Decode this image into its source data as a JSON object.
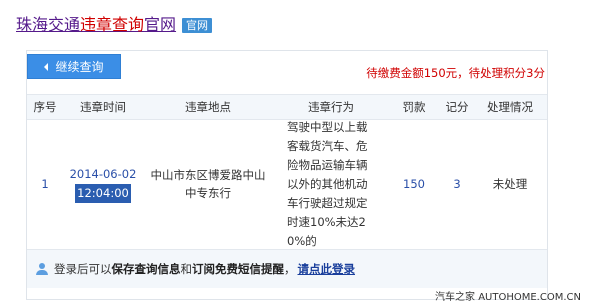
{
  "header": {
    "title_part1": "珠海交通",
    "title_highlight": "违章查询",
    "title_part2": "官网",
    "badge": "官网"
  },
  "toolbar": {
    "continue_label": "继续查询",
    "summary": "待缴费金额150元，待处理积分3分"
  },
  "table": {
    "columns": [
      "序号",
      "违章时间",
      "违章地点",
      "违章行为",
      "罚款",
      "记分",
      "处理情况"
    ],
    "rows": [
      {
        "index": "1",
        "date": "2014-06-02",
        "time": "12:04:00",
        "location_line1": "中山市东区博爱路中山",
        "location_line2": "中专东行",
        "behavior": "驾驶中型以上载客载货汽车、危险物品运输车辆以外的其他机动车行驶超过规定时速10%未达20%的",
        "fine": "150",
        "points": "3",
        "status": "未处理"
      }
    ]
  },
  "footer": {
    "text1": "登录后可以",
    "bold1": "保存查询信息",
    "text2": "和",
    "bold2": "订阅免费短信提醒",
    "text3": "，",
    "login_link": "请点此登录"
  },
  "watermark": "汽车之家 AUTOHOME.COM.CN",
  "colors": {
    "accent_blue": "#3b8ee6",
    "alert_red": "#d00000",
    "selection_blue": "#2a5db0"
  }
}
